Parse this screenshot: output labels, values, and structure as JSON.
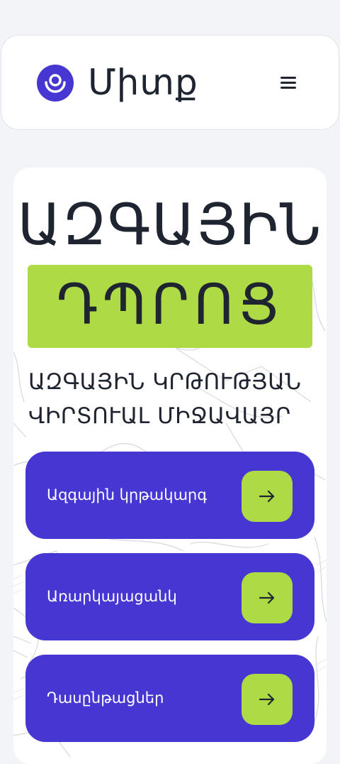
{
  "header": {
    "brand": "Միտք",
    "logo_icon": "eye-circle-logo-icon",
    "menu_icon": "hamburger-menu-icon"
  },
  "hero": {
    "title_line1": "ԱԶԳԱՅԻՆ",
    "title_line2": "ԴՊՐՈՑ",
    "subtitle_line1": "ԱԶԳԱՅԻՆ ԿՐԹՈՒԹՅԱՆ",
    "subtitle_line2": "ՎԻՐՏՈՒԱԼ ՄԻՋԱՎԱՅՐ"
  },
  "actions": [
    {
      "label": "Ազգային կրթակարգ",
      "icon": "arrow-right-icon"
    },
    {
      "label": "Առարկայացանկ",
      "icon": "arrow-right-icon"
    },
    {
      "label": "Դասընթացներ",
      "icon": "arrow-right-icon"
    }
  ],
  "colors": {
    "accent": "#4637d2",
    "highlight": "#aedb45",
    "text": "#1f2530",
    "background": "#f3f4f8"
  }
}
